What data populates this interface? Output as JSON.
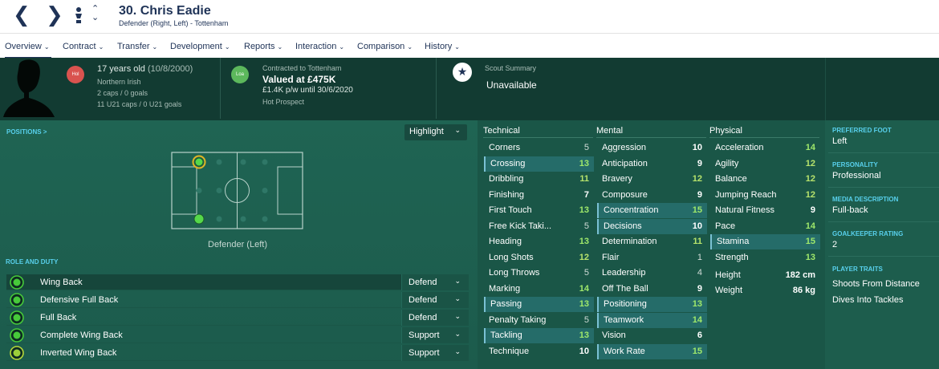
{
  "header": {
    "title": "30. Chris Eadie",
    "subtitle": "Defender (Right, Left) - Tottenham"
  },
  "menu": [
    {
      "label": "Overview"
    },
    {
      "label": "Contract"
    },
    {
      "label": "Transfer"
    },
    {
      "label": "Development"
    },
    {
      "label": "Reports"
    },
    {
      "label": "Interaction"
    },
    {
      "label": "Comparison"
    },
    {
      "label": "History"
    }
  ],
  "info": {
    "nationality_badge": "Hol",
    "age": "17 years old",
    "dob": "(10/8/2000)",
    "nationality": "Northern Irish",
    "caps": "2 caps / 0 goals",
    "u21_caps": "11 U21 caps / 0 U21 goals",
    "contract_badge": "Loa",
    "contract_label": "Contracted to Tottenham",
    "value": "Valued at £475K",
    "wage": "£1.4K p/w until 30/6/2020",
    "tag": "Hot Prospect",
    "scout_label": "Scout Summary",
    "scout_value": "Unavailable"
  },
  "positions": {
    "label": "POSITIONS >",
    "highlight_label": "Highlight",
    "caption": "Defender (Left)"
  },
  "roles": {
    "label": "ROLE AND DUTY",
    "items": [
      {
        "name": "Wing Back",
        "duty": "Defend"
      },
      {
        "name": "Defensive Full Back",
        "duty": "Defend"
      },
      {
        "name": "Full Back",
        "duty": "Defend"
      },
      {
        "name": "Complete Wing Back",
        "duty": "Support"
      },
      {
        "name": "Inverted Wing Back",
        "duty": "Support"
      }
    ]
  },
  "technical": {
    "label": "Technical",
    "items": [
      {
        "name": "Corners",
        "value": "5"
      },
      {
        "name": "Crossing",
        "value": "13"
      },
      {
        "name": "Dribbling",
        "value": "11"
      },
      {
        "name": "Finishing",
        "value": "7"
      },
      {
        "name": "First Touch",
        "value": "13"
      },
      {
        "name": "Free Kick Taki...",
        "value": "5"
      },
      {
        "name": "Heading",
        "value": "13"
      },
      {
        "name": "Long Shots",
        "value": "12"
      },
      {
        "name": "Long Throws",
        "value": "5"
      },
      {
        "name": "Marking",
        "value": "14"
      },
      {
        "name": "Passing",
        "value": "13"
      },
      {
        "name": "Penalty Taking",
        "value": "5"
      },
      {
        "name": "Tackling",
        "value": "13"
      },
      {
        "name": "Technique",
        "value": "10"
      }
    ]
  },
  "mental": {
    "label": "Mental",
    "items": [
      {
        "name": "Aggression",
        "value": "10"
      },
      {
        "name": "Anticipation",
        "value": "9"
      },
      {
        "name": "Bravery",
        "value": "12"
      },
      {
        "name": "Composure",
        "value": "9"
      },
      {
        "name": "Concentration",
        "value": "15"
      },
      {
        "name": "Decisions",
        "value": "10"
      },
      {
        "name": "Determination",
        "value": "11"
      },
      {
        "name": "Flair",
        "value": "1"
      },
      {
        "name": "Leadership",
        "value": "4"
      },
      {
        "name": "Off The Ball",
        "value": "9"
      },
      {
        "name": "Positioning",
        "value": "13"
      },
      {
        "name": "Teamwork",
        "value": "14"
      },
      {
        "name": "Vision",
        "value": "6"
      },
      {
        "name": "Work Rate",
        "value": "15"
      }
    ]
  },
  "physical": {
    "label": "Physical",
    "items": [
      {
        "name": "Acceleration",
        "value": "14"
      },
      {
        "name": "Agility",
        "value": "12"
      },
      {
        "name": "Balance",
        "value": "12"
      },
      {
        "name": "Jumping Reach",
        "value": "12"
      },
      {
        "name": "Natural Fitness",
        "value": "9"
      },
      {
        "name": "Pace",
        "value": "14"
      },
      {
        "name": "Stamina",
        "value": "15"
      },
      {
        "name": "Strength",
        "value": "13"
      }
    ],
    "height_label": "Height",
    "height_value": "182 cm",
    "weight_label": "Weight",
    "weight_value": "86 kg"
  },
  "side": {
    "preferred_foot_label": "PREFERRED FOOT",
    "preferred_foot": "Left",
    "personality_label": "PERSONALITY",
    "personality": "Professional",
    "media_label": "MEDIA DESCRIPTION",
    "media": "Full-back",
    "gk_label": "GOALKEEPER RATING",
    "gk": "2",
    "traits_label": "PLAYER TRAITS",
    "traits": [
      "Shoots From Distance",
      "Dives Into Tackles"
    ]
  },
  "colors": {
    "accent": "#58d0ec",
    "nav": "#1f3357",
    "good": "#9fe86b",
    "badge_red": "#d9534f",
    "badge_green": "#5cb85c"
  }
}
